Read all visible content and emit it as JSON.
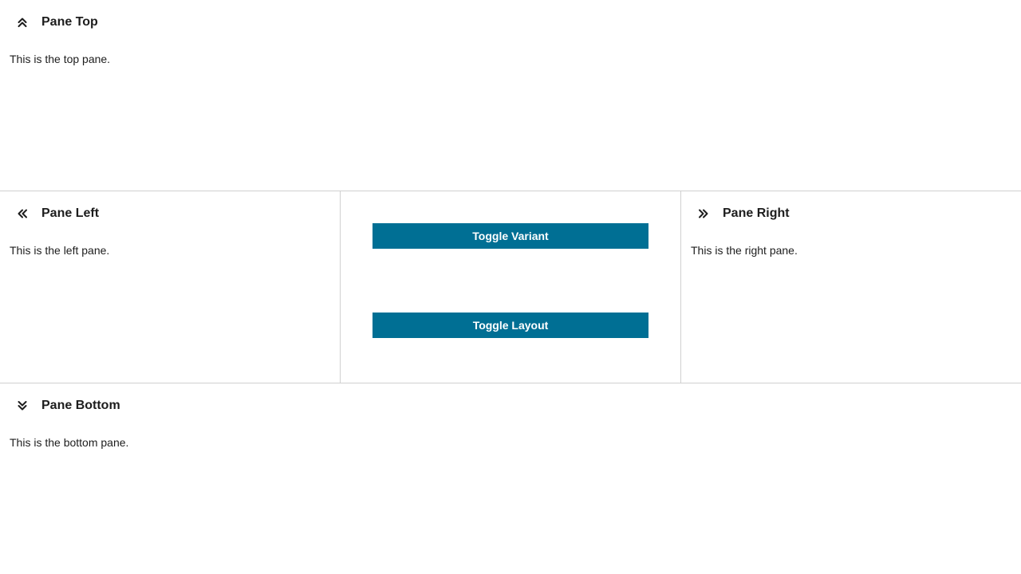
{
  "panes": {
    "top": {
      "title": "Pane Top",
      "text": "This is the top pane.",
      "icon": "chevrons-up-icon"
    },
    "left": {
      "title": "Pane Left",
      "text": "This is the left pane.",
      "icon": "chevrons-left-icon"
    },
    "right": {
      "title": "Pane Right",
      "text": "This is the right pane.",
      "icon": "chevrons-right-icon"
    },
    "bottom": {
      "title": "Pane Bottom",
      "text": "This is the bottom pane.",
      "icon": "chevrons-down-icon"
    }
  },
  "center": {
    "toggle_variant_label": "Toggle Variant",
    "toggle_layout_label": "Toggle Layout"
  },
  "colors": {
    "button_bg": "#006f94",
    "divider": "#d0d0d0",
    "text": "#1d1d1d"
  }
}
